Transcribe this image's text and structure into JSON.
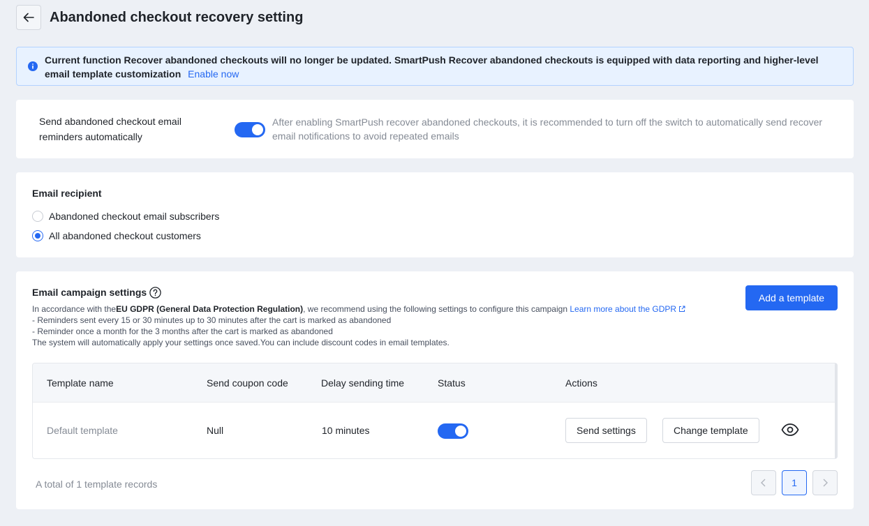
{
  "header": {
    "title": "Abandoned checkout recovery setting"
  },
  "banner": {
    "text": "Current function Recover abandoned checkouts will no longer be updated. SmartPush Recover abandoned checkouts is equipped with data reporting and higher-level email template customization",
    "link": "Enable now"
  },
  "auto_send": {
    "label": "Send abandoned checkout email reminders automatically",
    "enabled": true,
    "hint": "After enabling SmartPush recover abandoned checkouts, it is recommended to turn off the switch to automatically send recover email notifications to avoid repeated emails"
  },
  "recipient": {
    "title": "Email recipient",
    "options": [
      "Abandoned checkout email subscribers",
      "All abandoned checkout customers"
    ],
    "selected": "All abandoned checkout customers"
  },
  "campaign": {
    "title": "Email campaign settings",
    "add_button": "Add a template",
    "gdpr_prefix": "In accordance with the",
    "gdpr_bold": "EU GDPR (General Data Protection Regulation)",
    "gdpr_suffix": ", we recommend using the following settings to configure this campaign",
    "gdpr_link": "Learn more about the GDPR",
    "line1": "- Reminders sent every 15 or 30 minutes up to 30 minutes after the cart is marked as abandoned",
    "line2": "- Reminder once a month for the 3 months after the cart is marked as abandoned",
    "line3": "The system will automatically apply your settings once saved.You can include discount codes in email templates."
  },
  "table": {
    "columns": [
      "Template name",
      "Send coupon code",
      "Delay sending time",
      "Status",
      "Actions"
    ],
    "rows": [
      {
        "name": "Default template",
        "coupon": "Null",
        "delay": "10 minutes",
        "status_enabled": true,
        "send_settings": "Send settings",
        "change_template": "Change template"
      }
    ]
  },
  "pagination": {
    "total_text": "A total of 1 template records",
    "current_page": "1"
  },
  "colors": {
    "primary": "#2468f2",
    "background": "#edf0f5",
    "banner_bg": "#e8f2ff"
  }
}
